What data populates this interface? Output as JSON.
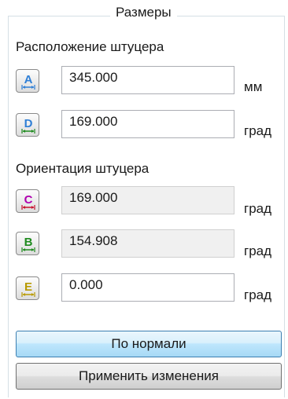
{
  "group": {
    "title": "Размеры"
  },
  "position_section": {
    "label": "Расположение штуцера"
  },
  "orientation_section": {
    "label": "Ориентация штуцера"
  },
  "fields": [
    {
      "letter": "A",
      "value": "345.000",
      "unit": "мм",
      "readonly": false,
      "color": "#2f7fd6"
    },
    {
      "letter": "D",
      "value": "169.000",
      "unit": "град",
      "readonly": false,
      "color": "#2f7fd6"
    },
    {
      "letter": "C",
      "value": "169.000",
      "unit": "град",
      "readonly": true,
      "color": "#b000b0"
    },
    {
      "letter": "B",
      "value": "154.908",
      "unit": "град",
      "readonly": true,
      "color": "#1e8a1e"
    },
    {
      "letter": "E",
      "value": "0.000",
      "unit": "град",
      "readonly": false,
      "color": "#b89a00"
    }
  ],
  "buttons": {
    "normal": "По нормали",
    "apply": "Применить изменения"
  },
  "icons": {
    "dimension_icon": "dimension-arrow-icon"
  }
}
